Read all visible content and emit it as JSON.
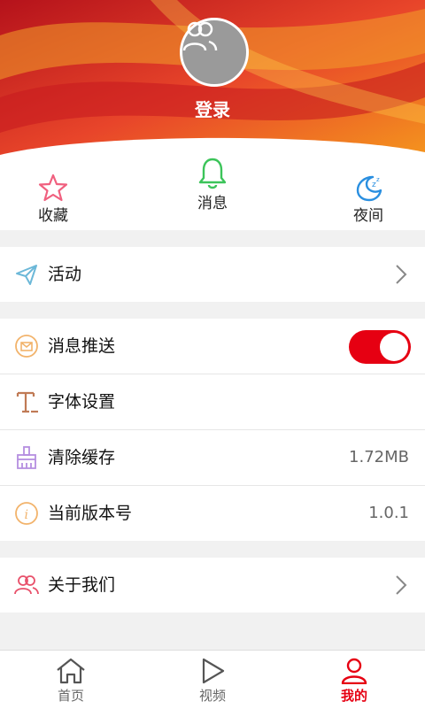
{
  "colors": {
    "accent": "#e60012",
    "header_red": "#d8262b",
    "header_orange": "#f07a1a"
  },
  "header": {
    "login_label": "登录",
    "avatar_icon": "users-icon"
  },
  "quick_actions": [
    {
      "label": "收藏",
      "icon": "star-icon"
    },
    {
      "label": "消息",
      "icon": "bell-icon"
    },
    {
      "label": "夜间",
      "icon": "moon-icon"
    }
  ],
  "activity": {
    "label": "活动",
    "icon": "send-icon"
  },
  "settings": {
    "push": {
      "label": "消息推送",
      "icon": "mail-icon",
      "enabled": true
    },
    "font": {
      "label": "字体设置",
      "icon": "font-icon"
    },
    "cache": {
      "label": "清除缓存",
      "icon": "broom-icon",
      "value": "1.72MB"
    },
    "version": {
      "label": "当前版本号",
      "icon": "info-icon",
      "value": "1.0.1"
    }
  },
  "about": {
    "label": "关于我们",
    "icon": "group-icon"
  },
  "tabbar": [
    {
      "label": "首页",
      "icon": "home-icon"
    },
    {
      "label": "视频",
      "icon": "play-icon"
    },
    {
      "label": "我的",
      "icon": "person-icon",
      "active": true
    }
  ]
}
